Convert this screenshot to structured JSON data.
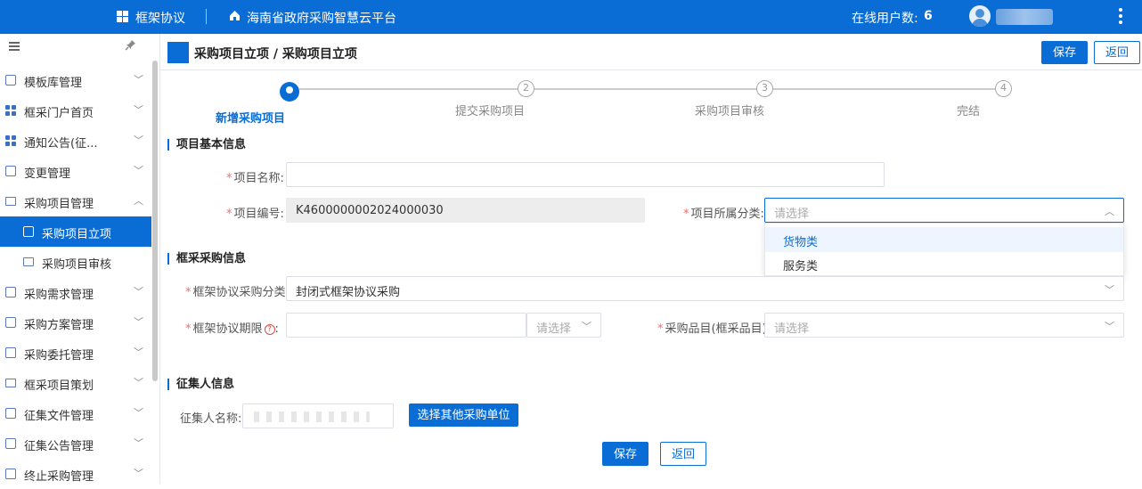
{
  "topbar": {
    "app_title": "框架协议",
    "platform_title": "海南省政府采购智慧云平台",
    "online_label": "在线用户数:",
    "online_count": "6"
  },
  "sidebar": {
    "items": [
      {
        "label": "模板库管理",
        "icon": "template-icon"
      },
      {
        "label": "框采门户首页",
        "icon": "grid-icon"
      },
      {
        "label": "通知公告(征...",
        "icon": "grid-icon"
      },
      {
        "label": "变更管理",
        "icon": "change-icon"
      },
      {
        "label": "采购项目管理",
        "icon": "folder-icon",
        "expanded": true
      },
      {
        "label": "采购项目立项",
        "icon": "doc-icon",
        "active": true
      },
      {
        "label": "采购项目审核",
        "icon": "folder-icon"
      },
      {
        "label": "采购需求管理",
        "icon": "doc-icon"
      },
      {
        "label": "采购方案管理",
        "icon": "doc-icon"
      },
      {
        "label": "采购委托管理",
        "icon": "doc-icon"
      },
      {
        "label": "框采项目策划",
        "icon": "folder-icon"
      },
      {
        "label": "征集文件管理",
        "icon": "doc-icon"
      },
      {
        "label": "征集公告管理",
        "icon": "doc-icon"
      },
      {
        "label": "终止采购管理",
        "icon": "terminate-icon"
      }
    ]
  },
  "page": {
    "title": "采购项目立项 / 采购项目立项",
    "save_label": "保存",
    "back_label": "返回"
  },
  "steps": [
    {
      "label": "新增采购项目",
      "num": "",
      "active": true
    },
    {
      "label": "提交采购项目",
      "num": "2"
    },
    {
      "label": "采购项目审核",
      "num": "3"
    },
    {
      "label": "完结",
      "num": "4"
    }
  ],
  "basic": {
    "section_title": "项目基本信息",
    "name_label": "项目名称:",
    "name_value": "",
    "code_label": "项目编号:",
    "code_value": "K4600000002024000030",
    "category_label": "项目所属分类:",
    "category_placeholder": "请选择",
    "category_options": [
      "货物类",
      "服务类"
    ]
  },
  "framework": {
    "section_title": "框采采购信息",
    "type_label": "框架协议采购分类:",
    "type_value": "封闭式框架协议采购",
    "period_label": "框架协议期限",
    "period_unit_placeholder": "请选择",
    "item_label": "采购品目(框采品目)",
    "item_placeholder": "请选择"
  },
  "collector": {
    "section_title": "征集人信息",
    "name_label": "征集人名称:",
    "select_button": "选择其他采购单位"
  },
  "footer": {
    "save_label": "保存",
    "back_label": "返回"
  },
  "colors": {
    "primary": "#0a6dd6",
    "required": "#f56c6c"
  }
}
